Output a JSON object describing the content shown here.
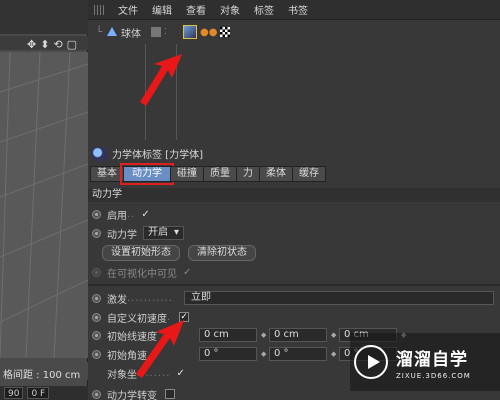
{
  "menu": [
    "文件",
    "编辑",
    "查看",
    "对象",
    "标签",
    "书签"
  ],
  "object": {
    "name": "球体"
  },
  "attributes": {
    "title": "力学体标签 [力学体]",
    "tabs": [
      "基本",
      "动力学",
      "碰撞",
      "质量",
      "力",
      "柔体",
      "缓存"
    ],
    "active_tab": "动力学",
    "section": "动力学",
    "enabled": {
      "label": "启用",
      "value": "✓"
    },
    "dynamics": {
      "label": "动力学",
      "value": "开启",
      "arrow": "▾"
    },
    "buttons": {
      "set_initial": "设置初始形态",
      "clear_initial": "清除初状态"
    },
    "visible": {
      "label": "在可视化中可见",
      "value": "✓"
    },
    "trigger": {
      "label": "激发",
      "dots": "...........",
      "value": "立即"
    },
    "custom_velocity": {
      "label": "自定义初速度",
      "dots": ".",
      "value": "✓"
    },
    "initial_linear": {
      "label": "初始线速度",
      "values": [
        "0 cm",
        "0 cm",
        "0 cm"
      ]
    },
    "initial_angular": {
      "label": "初始角速",
      "values": [
        "0 °",
        "0 °",
        "0 °"
      ]
    },
    "object_coords": {
      "label": "对象坐",
      "dots": "........",
      "value": "✓"
    },
    "dynamic_transform": {
      "label": "动力学转变"
    }
  },
  "viewport": {
    "grid_spacing": "格间距 : 100 cm",
    "bottom_values": [
      "90",
      "0 F"
    ],
    "nav_icons": [
      "✥",
      "⬍",
      "⟲",
      "▢"
    ]
  },
  "watermark": {
    "title": "溜溜自学",
    "subtitle": "ZIXUE.3D66.COM"
  },
  "colors": {
    "accent_tab": "#6a8ec4",
    "highlight_red": "#e02020",
    "panel": "#383838"
  }
}
